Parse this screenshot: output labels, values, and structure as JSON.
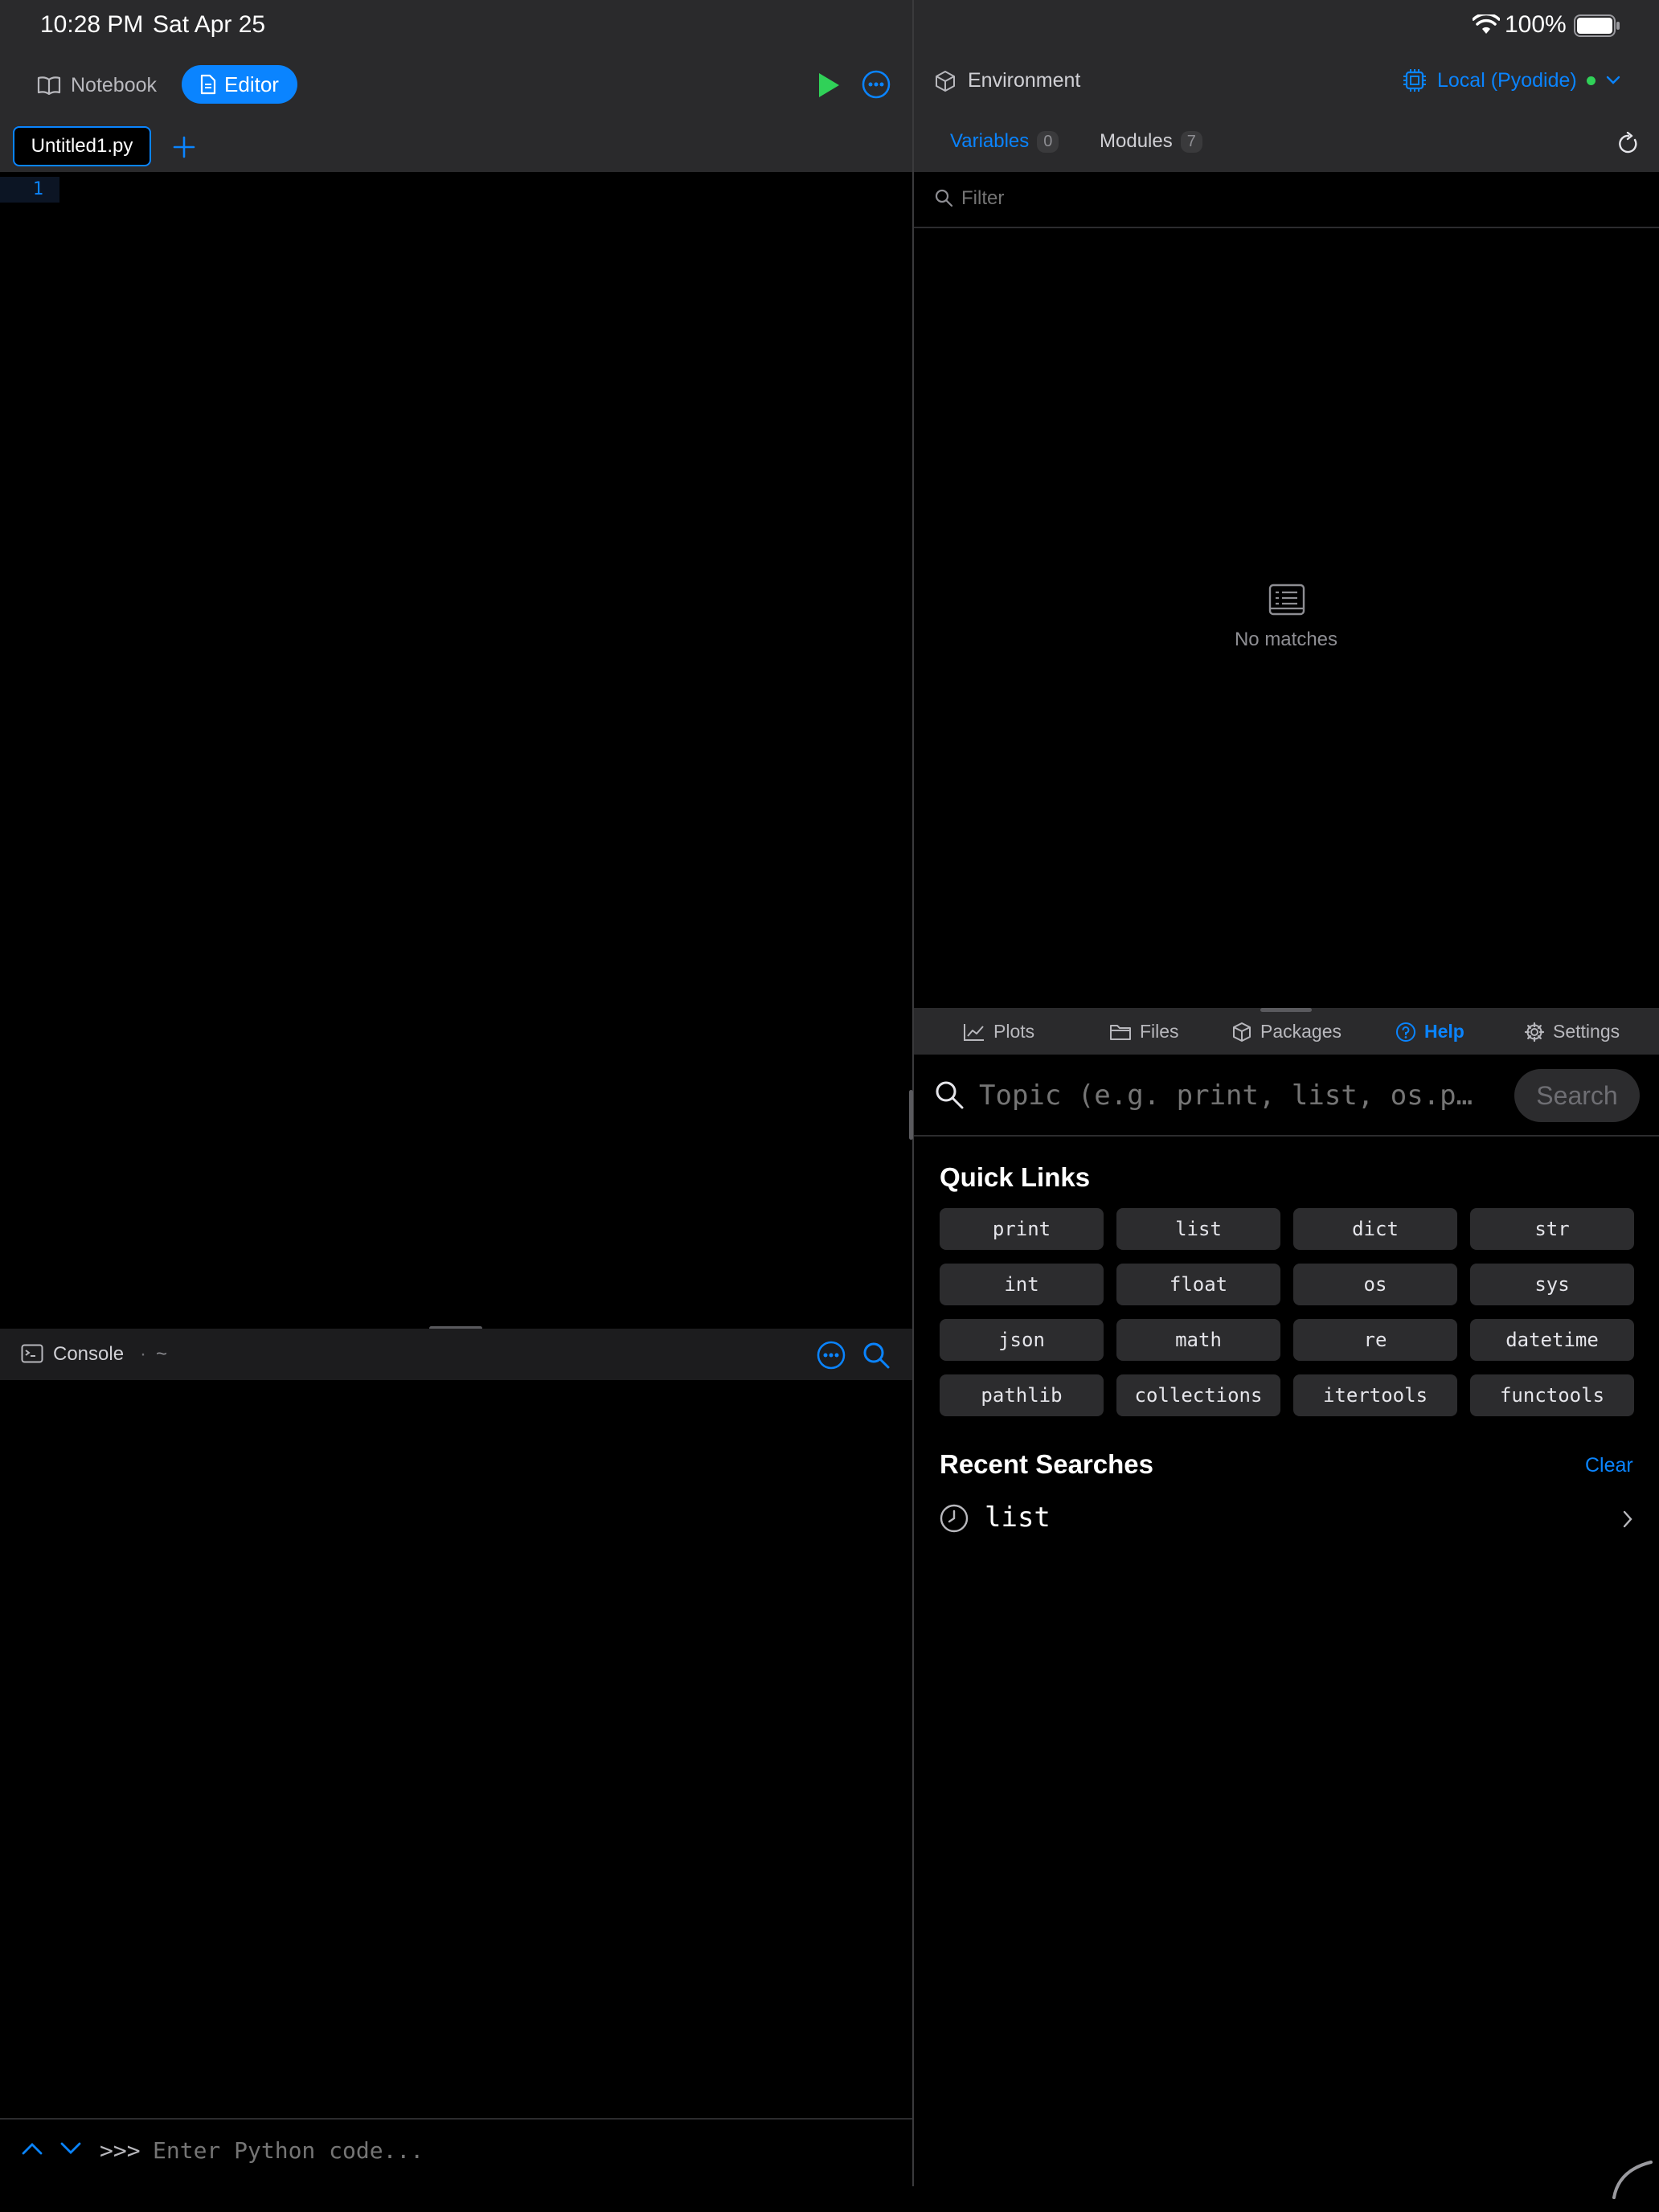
{
  "status_bar": {
    "time": "10:28 PM",
    "date": "Sat Apr 25",
    "battery_percent": "100%"
  },
  "left_toolbar": {
    "notebook_label": "Notebook",
    "editor_label": "Editor"
  },
  "file_tabs": [
    {
      "label": "Untitled1.py"
    }
  ],
  "editor": {
    "line_numbers": [
      "1"
    ]
  },
  "console": {
    "title": "Console",
    "separator": "·",
    "path": "~",
    "prompt": ">>>",
    "input_placeholder": "Enter Python code..."
  },
  "environment": {
    "title": "Environment",
    "kernel_label": "Local (Pyodide)",
    "kernel_status_color": "#30d158",
    "tabs": [
      {
        "label": "Variables",
        "count": "0",
        "active": true
      },
      {
        "label": "Modules",
        "count": "7",
        "active": false
      }
    ],
    "filter_placeholder": "Filter",
    "empty_message": "No matches"
  },
  "bottom_tabs": [
    {
      "label": "Plots",
      "icon": "chart-icon"
    },
    {
      "label": "Files",
      "icon": "folder-icon"
    },
    {
      "label": "Packages",
      "icon": "package-icon"
    },
    {
      "label": "Help",
      "icon": "question-icon",
      "active": true
    },
    {
      "label": "Settings",
      "icon": "gear-icon"
    }
  ],
  "help": {
    "search_placeholder": "Topic (e.g. print, list, os.p…",
    "search_button": "Search",
    "quick_links_title": "Quick Links",
    "quick_links": [
      "print",
      "list",
      "dict",
      "str",
      "int",
      "float",
      "os",
      "sys",
      "json",
      "math",
      "re",
      "datetime",
      "pathlib",
      "collections",
      "itertools",
      "functools"
    ],
    "recent_title": "Recent Searches",
    "clear_label": "Clear",
    "recent": [
      {
        "label": "list"
      }
    ]
  },
  "colors": {
    "accent": "#0a84ff",
    "run_green": "#30d158",
    "toolbar_bg": "#2a2a2c"
  }
}
